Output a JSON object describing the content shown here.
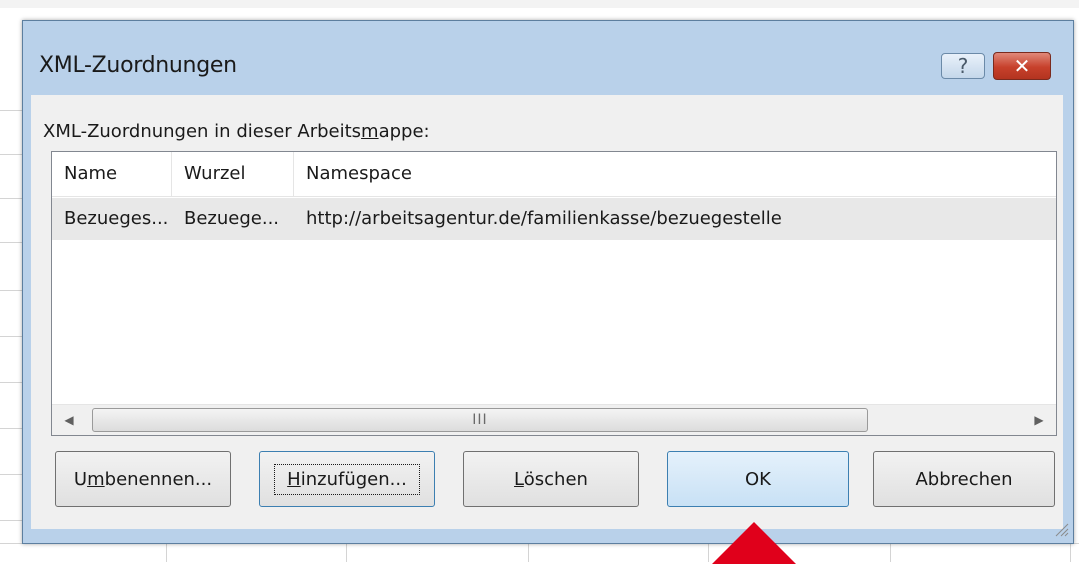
{
  "dialog": {
    "title": "XML-Zuordnungen",
    "help_label": "?",
    "close_label": "✕",
    "section_label_pre": "XML-Zuordnungen in dieser Arbeits",
    "section_label_mnemonic": "m",
    "section_label_post": "appe:"
  },
  "table": {
    "columns": [
      "Name",
      "Wurzel",
      "Namespace"
    ],
    "rows": [
      {
        "name": "Bezueges...",
        "root": "Bezuege...",
        "namespace": "http://arbeitsagentur.de/familienkasse/bezuegestelle"
      }
    ],
    "scroll_grip": "III"
  },
  "buttons": {
    "rename": {
      "pre": "U",
      "mnemonic": "m",
      "post": "benennen..."
    },
    "add": {
      "pre": "",
      "mnemonic": "H",
      "post": "inzufügen..."
    },
    "delete": {
      "pre": "",
      "mnemonic": "L",
      "post": "öschen"
    },
    "ok": "OK",
    "cancel": "Abbrechen"
  },
  "colors": {
    "title_bg": "#b9d1ea",
    "close_red": "#c7402b",
    "marker_red": "#e0001b"
  }
}
